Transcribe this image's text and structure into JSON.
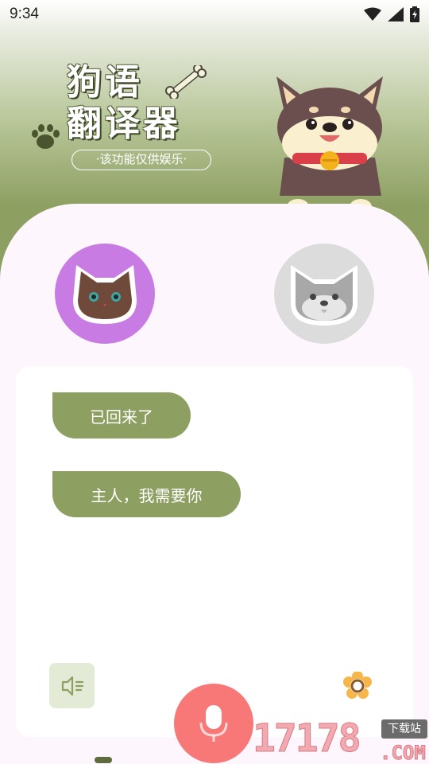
{
  "status_bar": {
    "time": "9:34",
    "icons": [
      "wifi-icon",
      "cell-signal-icon",
      "battery-charging-icon"
    ]
  },
  "header": {
    "title_line1": "狗语",
    "title_line2": "翻译器",
    "subtitle": "·该功能仅供娱乐·"
  },
  "avatars": {
    "left": "cat-avatar-icon",
    "right": "dog-avatar-icon"
  },
  "chat": {
    "messages": [
      {
        "text": "已回来了"
      },
      {
        "text": "主人，我需要你"
      }
    ]
  },
  "controls": {
    "speaker": "speaker-icon",
    "settings": "settings-flower-icon",
    "mic": "microphone-icon"
  },
  "watermark": {
    "number": "17178",
    "badge": "下载站",
    "domain": ".COM"
  },
  "colors": {
    "accent_green": "#8e9f62",
    "mic_red": "#f77877",
    "cat_purple": "#c77be3",
    "panel_bg": "#fdf7fd"
  }
}
